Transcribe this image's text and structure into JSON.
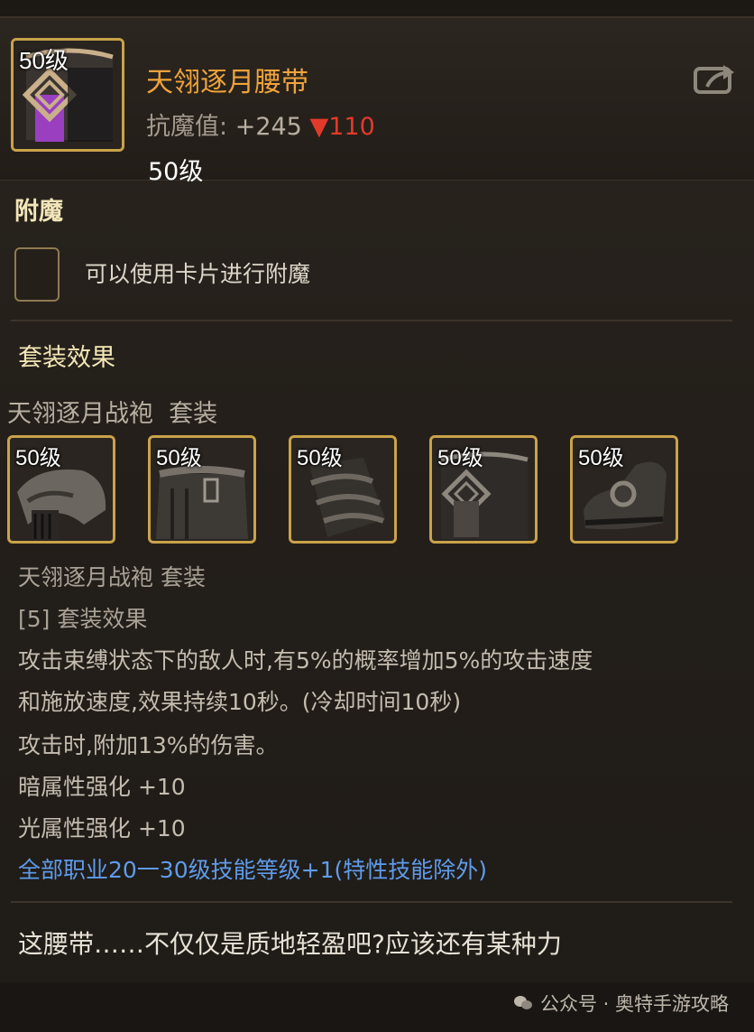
{
  "item": {
    "level_badge": "50级",
    "name": "天翎逐月腰带",
    "stat_label": "抗魔值:",
    "stat_value": "+245",
    "stat_change": "▼110",
    "required_level": "50级"
  },
  "enchant": {
    "title": "附魔",
    "hint": "可以使用卡片进行附魔"
  },
  "set": {
    "title": "套装效果",
    "name_line": "天翎逐月战袍  套装",
    "items": [
      {
        "level": "50级",
        "icon": "shoulder-armor-icon"
      },
      {
        "level": "50级",
        "icon": "chest-armor-icon"
      },
      {
        "level": "50级",
        "icon": "leg-armor-icon"
      },
      {
        "level": "50级",
        "icon": "belt-icon"
      },
      {
        "level": "50级",
        "icon": "boots-icon"
      }
    ],
    "desc_name": "天翎逐月战袍  套装",
    "desc_count": "[5] 套装效果",
    "effect_lines": [
      "攻击束缚状态下的敌人时,有5%的概率增加5%的攻击速度",
      "和施放速度,效果持续10秒。(冷却时间10秒)",
      "攻击时,附加13%的伤害。",
      "暗属性强化 +10",
      "光属性强化 +10"
    ],
    "skill_line": "全部职业20一30级技能等级+1(特性技能除外)"
  },
  "flavor": "这腰带……不仅仅是质地轻盈吧?应该还有某种力",
  "watermark": "公众号 · 奥特手游攻略",
  "colors": {
    "name": "#f0a33a",
    "stat_down": "#e23a2a",
    "skill_line": "#5f9bea",
    "icon_border": "#c9a24a"
  }
}
